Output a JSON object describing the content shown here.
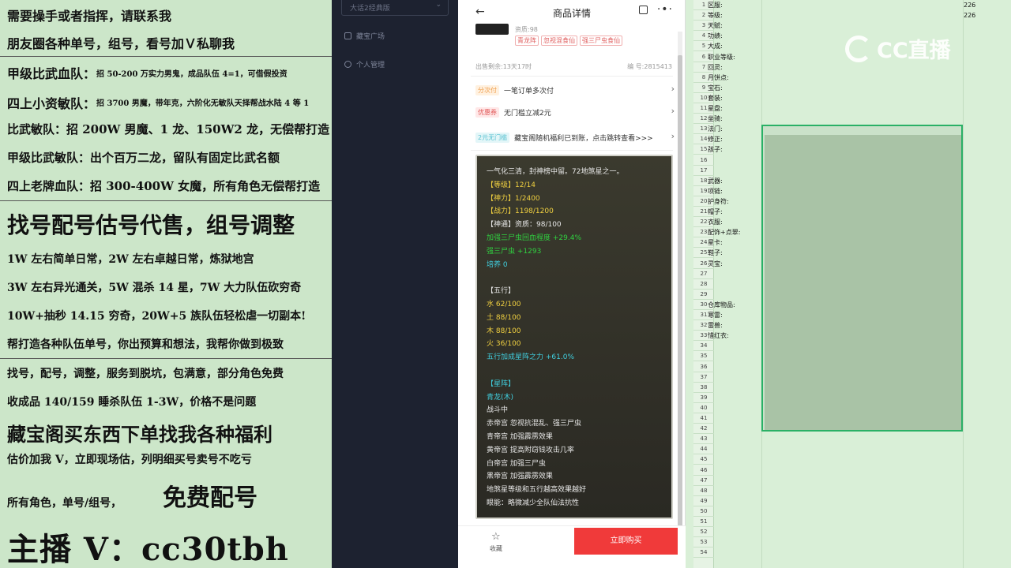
{
  "banner": {
    "lines": [
      "需要操手或者指挥，请联系我",
      "朋友圈各种单号，组号，看号加Ｖ私聊我",
      "甲级比武血队：",
      "招 50-200 万实力男鬼，成品队伍 4=1，可借假投资",
      "四上小资敏队：",
      "招 3700 男魔，带年克，六阶化无敏队天择帮战水陆 4 等 1",
      "比武敏队：招 200W 男魔、1 龙、150W2 龙，无偿帮打造",
      "甲级比武敏队：出个百万二龙，留队有固定比武名额",
      "四上老牌血队：招 300-400W 女魔，所有角色无偿帮打造",
      "找号配号估号代售，组号调整",
      "1W 左右简单日常，2W 左右卓越日常，炼狱地宫",
      "3W 左右异光通关，5W 混杀 14 星，7W 大力队伍砍穷奇",
      "10W+抽秒 14.15 穷奇，20W+5 族队伍轻松虐一切副本!",
      "帮打造各种队伍单号，你出预算和想法，我帮你做到极致",
      "找号，配号，调整，服务到脱坑，包满意，部分角色免费",
      "收成品 140/159 睡杀队伍 1-3W，价格不是问题",
      "藏宝阁买东西下单找我各种福利",
      "估价加我 V，立即现场估，列明细买号卖号不吃亏",
      "所有角色，单号/组号，",
      "免费配号",
      "主播 V：cc30tbh"
    ]
  },
  "sidebar": {
    "select_label": "大话2经典版",
    "items": [
      "藏宝广场",
      "个人管理"
    ]
  },
  "phone": {
    "title": "商品详情",
    "grade": "资质:98",
    "tags": [
      "青龙阵",
      "忽视混食仙",
      "强三尸虫食仙"
    ],
    "listed": "出售剩余:13天17时",
    "code": "编 号:2815413",
    "rows": [
      {
        "badge": "分次付",
        "text": "一笔订单多次付"
      },
      {
        "badge": "优惠券",
        "text": "无门槛立减2元"
      },
      {
        "badge": "2元无门槛",
        "text": "藏宝阁随机福利已到账，点击跳转查看>>>"
      }
    ],
    "card_lines": [
      {
        "t": "一气化三清，封神榜中留。72地煞星之一。",
        "c": "white"
      },
      {
        "t": "【等级】12/14",
        "c": "yellow"
      },
      {
        "t": "【神力】1/2400",
        "c": "yellow"
      },
      {
        "t": "【战力】1198/1200",
        "c": "yellow"
      },
      {
        "t": "【神通】资质：98/100",
        "c": "white"
      },
      {
        "t": "加强三尸虫回血程度 +29.4%",
        "c": "green"
      },
      {
        "t": "强三尸虫 +1293",
        "c": "green"
      },
      {
        "t": "培养 0",
        "c": "cyan"
      },
      {
        "t": "",
        "c": "white"
      },
      {
        "t": "【五行】",
        "c": "white"
      },
      {
        "t": "水 62/100",
        "c": "yellow"
      },
      {
        "t": "土 88/100",
        "c": "yellow"
      },
      {
        "t": "木 88/100",
        "c": "yellow"
      },
      {
        "t": "火 36/100",
        "c": "yellow"
      },
      {
        "t": "五行加成星阵之力 +61.0%",
        "c": "cyan"
      },
      {
        "t": "",
        "c": "white"
      },
      {
        "t": "【星阵】",
        "c": "cyan"
      },
      {
        "t": "青龙(木)",
        "c": "cyan"
      },
      {
        "t": "战斗中",
        "c": "white"
      },
      {
        "t": "赤帝宫 忽视抗混乱、强三尸虫",
        "c": "white"
      },
      {
        "t": "青帝宫 加强霹雳效果",
        "c": "white"
      },
      {
        "t": "黄帝宫 提高附窃钱攻击几率",
        "c": "white"
      },
      {
        "t": "白帝宫 加强三尸虫",
        "c": "white"
      },
      {
        "t": "黑帝宫 加强霹雳效果",
        "c": "white"
      },
      {
        "t": "地煞星等级和五行越高效果越好",
        "c": "white"
      },
      {
        "t": "眼能：略微减少全队仙法抗性",
        "c": "white"
      }
    ],
    "fav_label": "收藏",
    "buy_label": "立即购买"
  },
  "sheet": {
    "row_numbers": [
      "1",
      "2",
      "3",
      "4",
      "5",
      "6",
      "7",
      "8",
      "9",
      "10",
      "11",
      "12",
      "13",
      "14",
      "15",
      "16",
      "17",
      "18",
      "19",
      "20",
      "21",
      "22",
      "23",
      "24",
      "25",
      "26",
      "27",
      "28",
      "29",
      "30",
      "31",
      "32",
      "33",
      "34",
      "35",
      "36",
      "37",
      "38",
      "39",
      "40",
      "41",
      "42",
      "43",
      "44",
      "45",
      "46",
      "47",
      "48",
      "49",
      "50",
      "51",
      "52",
      "53",
      "54"
    ],
    "labels": [
      {
        "row": 0,
        "text": "区服:"
      },
      {
        "row": 1,
        "text": "等级:"
      },
      {
        "row": 2,
        "text": "天赋:"
      },
      {
        "row": 3,
        "text": "功绩:"
      },
      {
        "row": 4,
        "text": "大成:"
      },
      {
        "row": 5,
        "text": "职业等级:"
      },
      {
        "row": 6,
        "text": "回灵:"
      },
      {
        "row": 7,
        "text": "月饼点:"
      },
      {
        "row": 8,
        "text": "宝石:"
      },
      {
        "row": 9,
        "text": "套装:"
      },
      {
        "row": 10,
        "text": "星盘:"
      },
      {
        "row": 11,
        "text": "坐骑:"
      },
      {
        "row": 12,
        "text": "法门:"
      },
      {
        "row": 13,
        "text": "修正:"
      },
      {
        "row": 14,
        "text": "孩子:"
      },
      {
        "row": 17,
        "text": "武器:"
      },
      {
        "row": 18,
        "text": "项链:"
      },
      {
        "row": 19,
        "text": "护身符:"
      },
      {
        "row": 20,
        "text": "帽子:"
      },
      {
        "row": 21,
        "text": "衣服:"
      },
      {
        "row": 22,
        "text": "配饰+点翠:"
      },
      {
        "row": 23,
        "text": "星卡:"
      },
      {
        "row": 24,
        "text": "鞋子:"
      },
      {
        "row": 25,
        "text": "灵宝:"
      },
      {
        "row": 29,
        "text": "仓库物品:"
      },
      {
        "row": 30,
        "text": "寒雷:"
      },
      {
        "row": 31,
        "text": "雷兽:"
      },
      {
        "row": 32,
        "text": "惜红衣:"
      }
    ],
    "values": [
      {
        "row": 0,
        "text": "226"
      },
      {
        "row": 1,
        "text": "226"
      }
    ],
    "watermark": "CC直播"
  }
}
